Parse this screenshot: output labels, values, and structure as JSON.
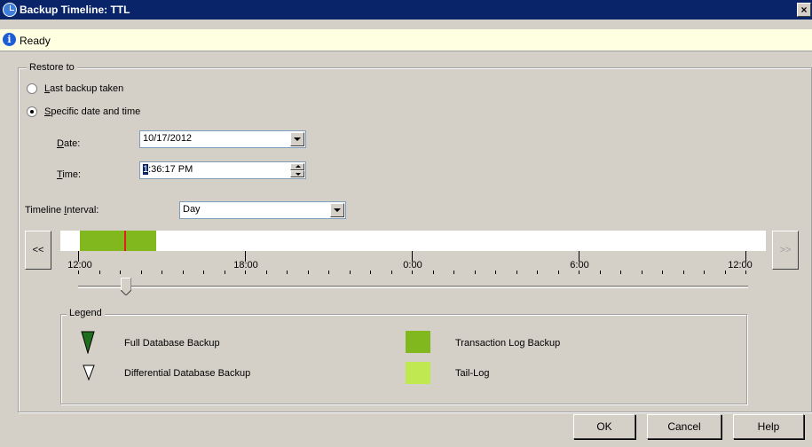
{
  "window": {
    "title": "Backup Timeline: TTL",
    "close_label": "×"
  },
  "status": {
    "icon": "info-icon",
    "text": "Ready"
  },
  "restore": {
    "group_label": "Restore to",
    "option_last": {
      "prefix": "",
      "accel": "L",
      "rest": "ast backup taken"
    },
    "option_specific": {
      "prefix": "",
      "accel": "S",
      "rest": "pecific date and time"
    },
    "selected": "specific",
    "date_label": {
      "accel": "D",
      "rest": "ate:"
    },
    "date_value": "10/17/2012",
    "time_label": {
      "accel": "T",
      "rest": "ime:"
    },
    "time_selected": "1",
    "time_rest": ":36:17 PM"
  },
  "timeline": {
    "interval_label": {
      "prefix": "Timeline ",
      "accel": "I",
      "rest": "nterval:"
    },
    "interval_value": "Day",
    "prev_label": "<<",
    "next_label": ">>",
    "tick_labels": [
      "12:00",
      "18:00",
      "0:00",
      "6:00",
      "12:00"
    ]
  },
  "legend": {
    "group_label": "Legend",
    "full": "Full Database Backup",
    "differential": "Differential Database Backup",
    "transaction": "Transaction Log Backup",
    "tail": "Tail-Log"
  },
  "buttons": {
    "ok": "OK",
    "cancel": "Cancel",
    "help": "Help"
  },
  "colors": {
    "titlebar": "#0a246a",
    "transaction_log": "#80b81e",
    "tail_log": "#c0e850",
    "full_backup": "#1e6e1e",
    "current_marker": "#e02020"
  }
}
